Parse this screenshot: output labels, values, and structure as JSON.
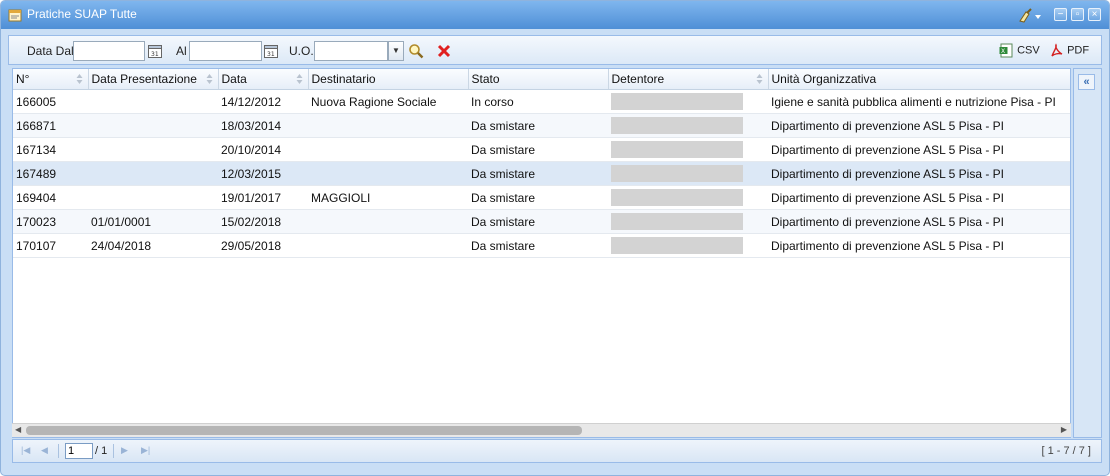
{
  "window": {
    "title": "Pratiche SUAP Tutte"
  },
  "toolbar": {
    "date_from_label": "Data Dal",
    "date_from_value": "",
    "date_to_label": "Al",
    "date_to_value": "",
    "uo_label": "U.O.",
    "uo_value": "",
    "csv_label": "CSV",
    "pdf_label": "PDF"
  },
  "grid": {
    "columns": [
      "N°",
      "Data Presentazione",
      "Data",
      "Destinatario",
      "Stato",
      "Detentore",
      "Unità Organizzativa"
    ],
    "rows": [
      {
        "n": "166005",
        "data_presentazione": "",
        "data": "14/12/2012",
        "destinatario": "Nuova Ragione Sociale",
        "stato": "In corso",
        "unita": "Igiene e sanità pubblica alimenti e nutrizione Pisa - PI"
      },
      {
        "n": "166871",
        "data_presentazione": "",
        "data": "18/03/2014",
        "destinatario": "",
        "stato": "Da smistare",
        "unita": "Dipartimento di prevenzione ASL 5 Pisa - PI"
      },
      {
        "n": "167134",
        "data_presentazione": "",
        "data": "20/10/2014",
        "destinatario": "",
        "stato": "Da smistare",
        "unita": "Dipartimento di prevenzione ASL 5 Pisa - PI"
      },
      {
        "n": "167489",
        "data_presentazione": "",
        "data": "12/03/2015",
        "destinatario": "",
        "stato": "Da smistare",
        "unita": "Dipartimento di prevenzione ASL 5 Pisa - PI"
      },
      {
        "n": "169404",
        "data_presentazione": "",
        "data": "19/01/2017",
        "destinatario": "MAGGIOLI",
        "stato": "Da smistare",
        "unita": "Dipartimento di prevenzione ASL 5 Pisa - PI"
      },
      {
        "n": "170023",
        "data_presentazione": "01/01/0001",
        "data": "15/02/2018",
        "destinatario": "",
        "stato": "Da smistare",
        "unita": "Dipartimento di prevenzione ASL 5 Pisa - PI"
      },
      {
        "n": "170107",
        "data_presentazione": "24/04/2018",
        "data": "29/05/2018",
        "destinatario": "",
        "stato": "Da smistare",
        "unita": "Dipartimento di prevenzione ASL 5 Pisa - PI"
      }
    ]
  },
  "pager": {
    "page_value": "1",
    "of_label": "/ 1",
    "info": "[ 1 - 7 / 7 ]"
  },
  "colors": {
    "titlebar": "#5f9ce0",
    "panel_bg": "#c9def5",
    "selected_row": "#dce8f6",
    "border": "#99bbe8"
  }
}
